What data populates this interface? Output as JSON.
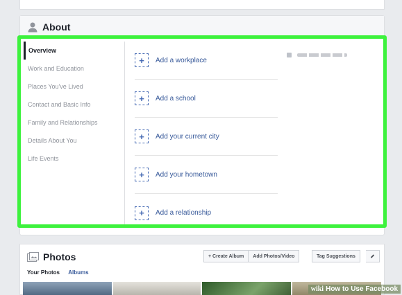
{
  "about": {
    "title": "About",
    "sidebar": [
      {
        "label": "Overview",
        "active": true
      },
      {
        "label": "Work and Education"
      },
      {
        "label": "Places You've Lived"
      },
      {
        "label": "Contact and Basic Info"
      },
      {
        "label": "Family and Relationships"
      },
      {
        "label": "Details About You"
      },
      {
        "label": "Life Events"
      }
    ],
    "add_items": [
      "Add a workplace",
      "Add a school",
      "Add your current city",
      "Add your hometown",
      "Add a relationship"
    ]
  },
  "photos": {
    "title": "Photos",
    "tabs": {
      "your_photos": "Your Photos",
      "albums": "Albums"
    },
    "buttons": {
      "create_album": "+ Create Album",
      "add_photos": "Add Photos/Video",
      "tag_suggestions": "Tag Suggestions"
    }
  },
  "watermark": {
    "brand": "wiki",
    "text": "How to Use Facebook"
  },
  "colors": {
    "highlight": "#3df23d",
    "link": "#365899",
    "accent": "#4267b2"
  }
}
